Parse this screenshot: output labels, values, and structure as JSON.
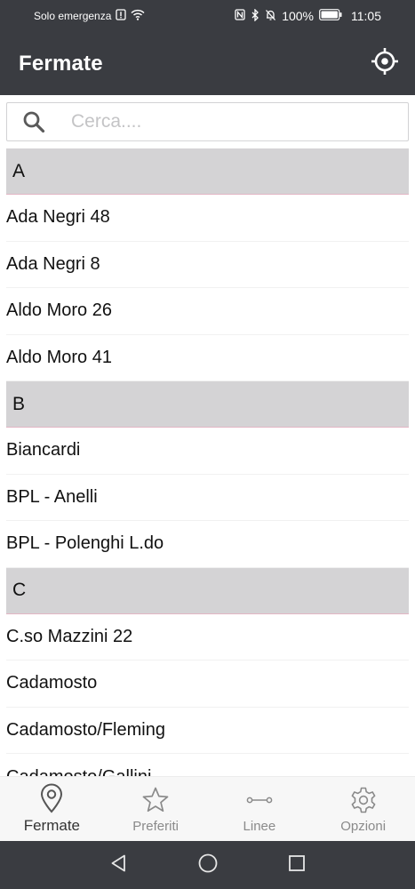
{
  "status_bar": {
    "carrier": "Solo emergenza",
    "battery": "100%",
    "time": "11:05"
  },
  "app_bar": {
    "title": "Fermate",
    "locate_icon": "crosshair-location-icon"
  },
  "search": {
    "placeholder": "Cerca....",
    "value": ""
  },
  "sections": [
    {
      "letter": "A",
      "stops": [
        "Ada Negri 48",
        "Ada Negri 8",
        "Aldo Moro 26",
        "Aldo Moro 41"
      ]
    },
    {
      "letter": "B",
      "stops": [
        "Biancardi",
        "BPL - Anelli",
        "BPL - Polenghi L.do"
      ]
    },
    {
      "letter": "C",
      "stops": [
        "C.so Mazzini 22",
        "Cadamosto",
        "Cadamosto/Fleming",
        "Cadamosto/Gallini"
      ]
    }
  ],
  "bottom_nav": {
    "items": [
      {
        "label": "Fermate",
        "icon": "map-pin-icon",
        "active": true
      },
      {
        "label": "Preferiti",
        "icon": "star-icon",
        "active": false
      },
      {
        "label": "Linee",
        "icon": "route-line-icon",
        "active": false
      },
      {
        "label": "Opzioni",
        "icon": "gear-icon",
        "active": false
      }
    ]
  },
  "colors": {
    "app_bar": "#3a3c41",
    "section_header": "#d4d3d5",
    "section_divider": "#e2b6c4",
    "nav_background": "#f7f7f7"
  }
}
